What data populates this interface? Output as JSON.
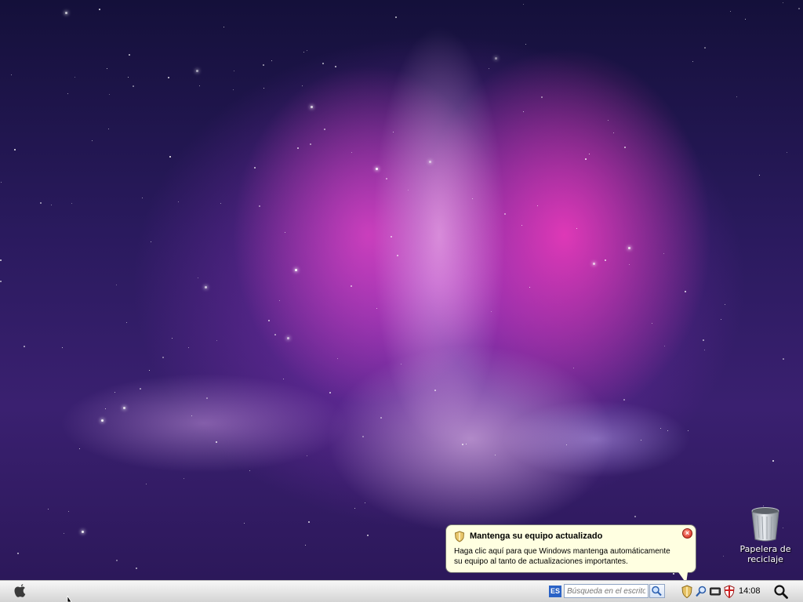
{
  "desktop": {
    "wallpaper": "purple aurora nebula",
    "icons": [
      {
        "name": "recycle-bin",
        "label_line1": "Papelera de",
        "label_line2": "reciclaje"
      }
    ]
  },
  "notification": {
    "title": "Mantenga su equipo actualizado",
    "body_line1": "Haga clic aquí para que Windows mantenga automáticamente",
    "body_line2": "su equipo al tanto de actualizaciones importantes.",
    "close_symbol": "×",
    "icon": "shield-icon"
  },
  "taskbar": {
    "start_icon": "apple-icon",
    "language": "ES",
    "search_placeholder": "Búsqueda en el escritorio",
    "search_button_icon": "search-icon",
    "tray_icons": [
      "shield-icon",
      "magnifier-icon",
      "display-icon",
      "security-shield-icon"
    ],
    "clock": "14:08",
    "spotlight_icon": "spotlight-icon"
  },
  "colors": {
    "balloon_background": "#ffffe1",
    "language_badge": "#2a62c6",
    "taskbar": "#e4e4e4"
  }
}
